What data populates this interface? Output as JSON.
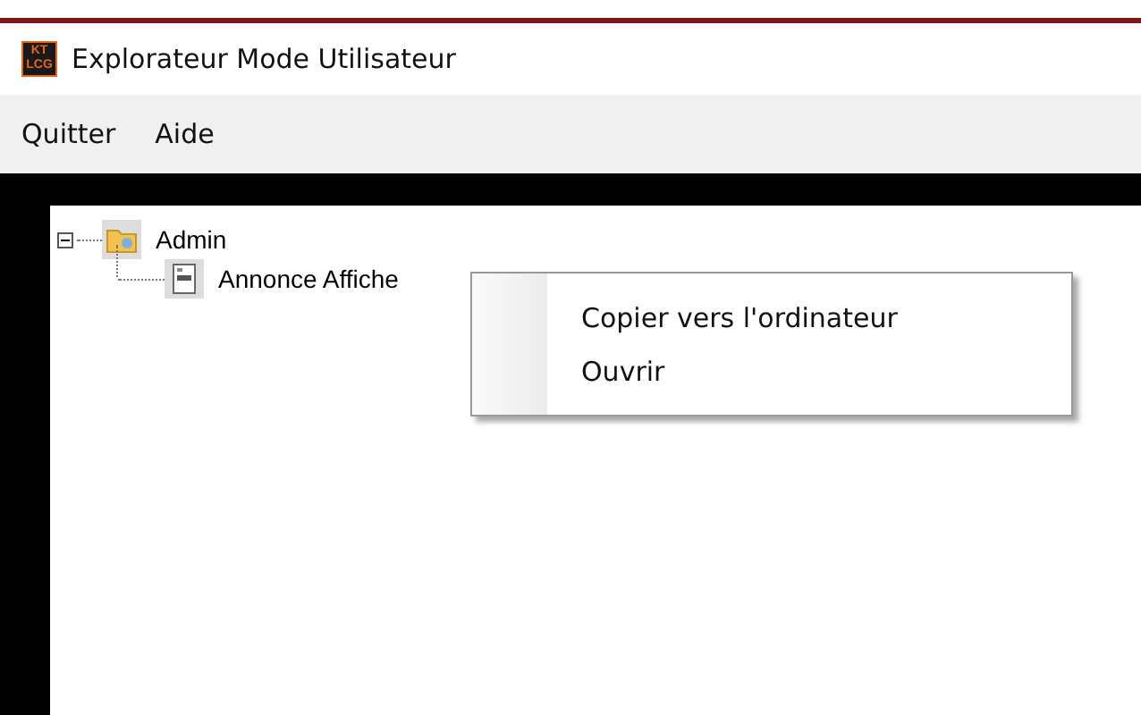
{
  "window": {
    "title": "Explorateur Mode Utilisateur",
    "logo": {
      "top": "KT",
      "bottom": "LCG"
    }
  },
  "menu_bar": [
    "Quitter",
    "Aide"
  ],
  "tree": [
    {
      "label": "Admin",
      "kind": "folder",
      "expanded": true,
      "children": [
        {
          "label": "Annonce Affiche",
          "kind": "document"
        }
      ]
    }
  ],
  "context_menu": [
    "Copier vers l'ordinateur",
    "Ouvrir"
  ]
}
